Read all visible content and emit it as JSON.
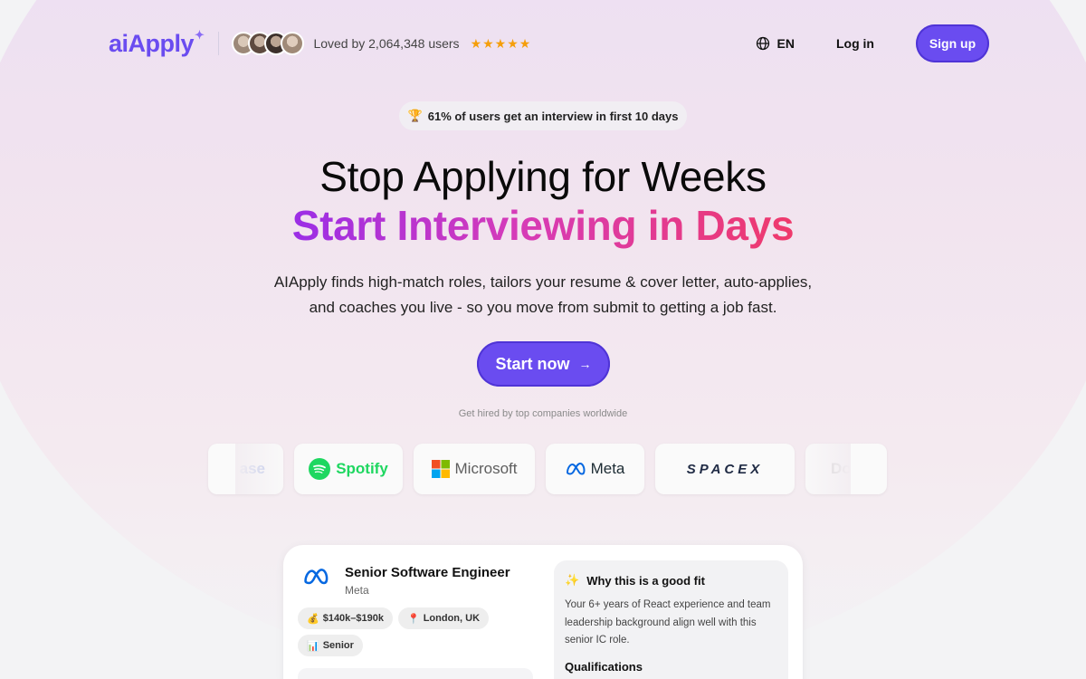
{
  "brand": {
    "name": "aiApply",
    "spark": "✦",
    "accent": "#6a4cf0"
  },
  "header": {
    "loved_text": "Loved by 2,064,348 users",
    "stars": "★★★★★",
    "language": "EN",
    "login": "Log in",
    "signup": "Sign up",
    "avatar_colors": [
      "#b8a89a",
      "#8d7f76",
      "#5a4d47",
      "#c9b8a8"
    ]
  },
  "hero": {
    "badge_icon": "🏆",
    "badge_text": "61% of users get an interview in first 10 days",
    "title_line1": "Stop Applying for Weeks",
    "title_line2": "Start Interviewing in Days",
    "subtitle": "AIApply finds high-match roles, tailors your resume & cover letter, auto-applies, and coaches you live - so you move from submit to getting a job fast.",
    "cta": "Start now",
    "cta_arrow": "→",
    "hired_text": "Get hired by top companies worldwide"
  },
  "companies": [
    {
      "name": "ase"
    },
    {
      "name": "Spotify",
      "color": "#1ed760"
    },
    {
      "name": "Microsoft",
      "color": "#505050"
    },
    {
      "name": "Meta",
      "color": "#1c2b33"
    },
    {
      "name": "SPACEX",
      "color": "#1f2a44"
    },
    {
      "name": "Do"
    }
  ],
  "job_card": {
    "title": "Senior Software Engineer",
    "company": "Meta",
    "salary_icon": "💰",
    "salary": "$140k–$190k",
    "location_icon": "📍",
    "location": "London, UK",
    "level_icon": "📊",
    "level": "Senior",
    "fit_icon": "✨",
    "fit_title": "Why this is a good fit",
    "fit_text": "Your 6+ years of React experience and team leadership background align well with this senior IC role.",
    "qualifications": "Qualifications"
  }
}
